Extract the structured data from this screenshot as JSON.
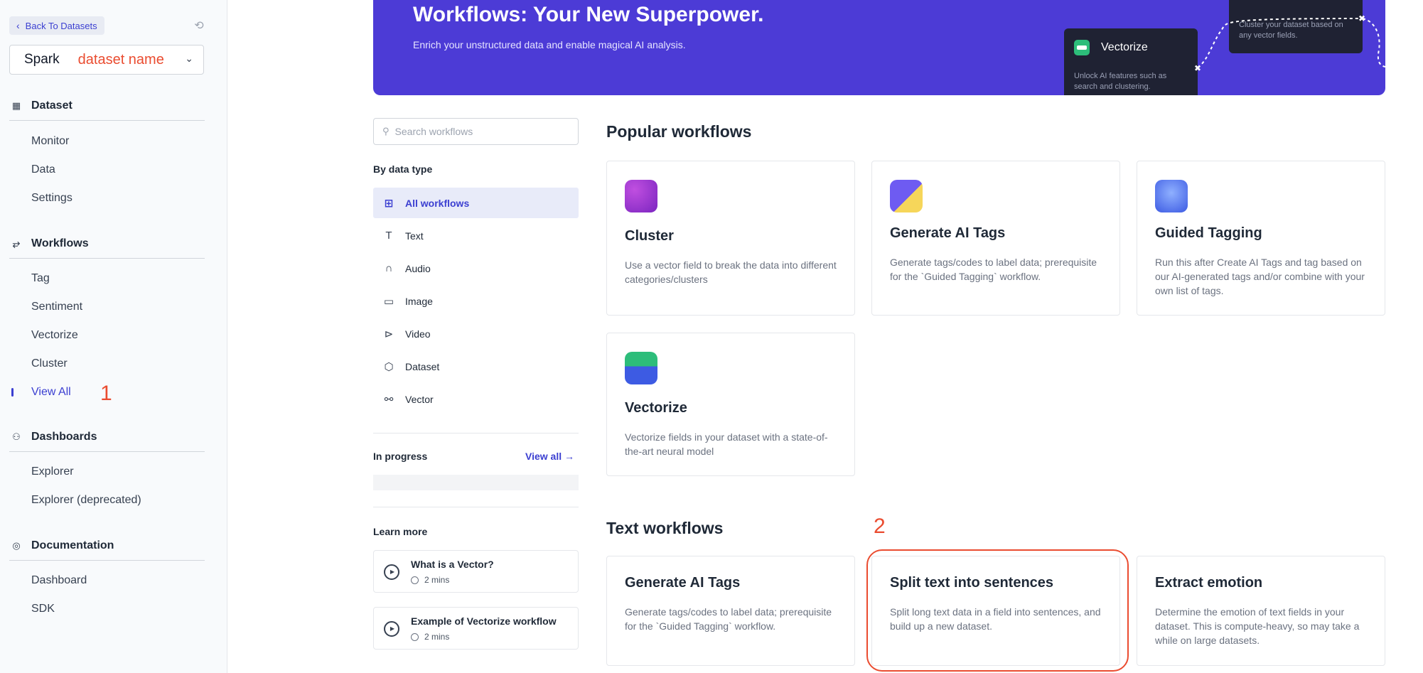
{
  "sidebar": {
    "back_label": "Back To Datasets",
    "dataset_name": "Spark",
    "dataset_annotation": "dataset name",
    "sections": [
      {
        "title": "Dataset",
        "icon": "table-icon",
        "items": [
          "Monitor",
          "Data",
          "Settings"
        ]
      },
      {
        "title": "Workflows",
        "icon": "workflow-icon",
        "items": [
          "Tag",
          "Sentiment",
          "Vectorize",
          "Cluster",
          "View All"
        ]
      },
      {
        "title": "Dashboards",
        "icon": "dashboard-icon",
        "items": [
          "Explorer",
          "Explorer (deprecated)"
        ]
      },
      {
        "title": "Documentation",
        "icon": "docs-icon",
        "items": [
          "Dashboard",
          "SDK"
        ]
      }
    ],
    "active_item": "View All",
    "annotation_1": "1"
  },
  "hero": {
    "title": "Workflows: Your New Superpower.",
    "subtitle": "Enrich your unstructured data and enable magical AI analysis.",
    "card_vectorize_title": "Vectorize",
    "card_vectorize_desc": "Unlock AI features such as search and clustering.",
    "card_cluster_desc": "Cluster your dataset based on any vector fields."
  },
  "filters": {
    "search_placeholder": "Search workflows",
    "by_type_label": "By data type",
    "types": [
      "All workflows",
      "Text",
      "Audio",
      "Image",
      "Video",
      "Dataset",
      "Vector"
    ],
    "active_type": "All workflows",
    "in_progress_label": "In progress",
    "view_all_label": "View all",
    "learn_more_label": "Learn more",
    "learn_items": [
      {
        "title": "What is a Vector?",
        "duration": "2 mins"
      },
      {
        "title": "Example of Vectorize workflow",
        "duration": "2 mins"
      }
    ]
  },
  "popular": {
    "heading": "Popular workflows",
    "cards": [
      {
        "title": "Cluster",
        "desc": "Use a vector field to break the data into different categories/clusters"
      },
      {
        "title": "Generate AI Tags",
        "desc": "Generate tags/codes to label data; prerequisite for the `Guided Tagging` workflow."
      },
      {
        "title": "Guided Tagging",
        "desc": "Run this after Create AI Tags and tag based on our AI-generated tags and/or combine with your own list of tags."
      },
      {
        "title": "Vectorize",
        "desc": "Vectorize fields in your dataset with a state-of-the-art neural model"
      }
    ]
  },
  "text_workflows": {
    "heading": "Text workflows",
    "annotation_2": "2",
    "cards": [
      {
        "title": "Generate AI Tags",
        "desc": "Generate tags/codes to label data; prerequisite for the `Guided Tagging` workflow."
      },
      {
        "title": "Split text into sentences",
        "desc": "Split long text data in a field into sentences, and build up a new dataset."
      },
      {
        "title": "Extract emotion",
        "desc": "Determine the emotion of text fields in your dataset. This is compute-heavy, so may take a while on large datasets."
      }
    ]
  },
  "colors": {
    "accent": "#3b3fd1",
    "hero": "#4c3bd6",
    "annotation": "#ea4c30"
  }
}
